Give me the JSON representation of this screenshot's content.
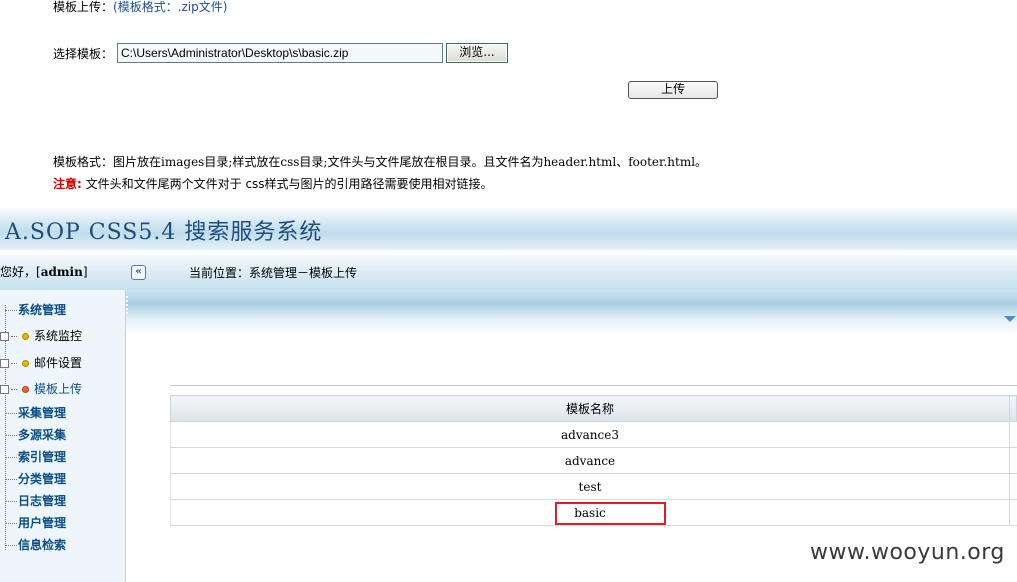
{
  "upload_form": {
    "title_label": "模板上传：",
    "title_hint": "(模板格式：.zip文件)",
    "select_label": "选择模板：",
    "file_path": "C:\\Users\\Administrator\\Desktop\\s\\basic.zip",
    "browse_label": "浏览...",
    "upload_label": "上传",
    "format_prefix": "模板格式：",
    "format_text": "图片放在images目录;样式放在css目录;文件头与文件尾放在根目录。且文件名为header.html、footer.html。",
    "note_label": "注意:",
    "note_text": "文件头和文件尾两个文件对于 css样式与图片的引用路径需要使用相对链接。"
  },
  "app": {
    "title": "A.SOP CSS5.4 搜索服务系统",
    "greeting_prefix": "您好，[",
    "username": "admin",
    "greeting_suffix": "]",
    "collapse_icon": "double-chevron-left-icon",
    "collapse_glyph": "«",
    "location": "当前位置：系统管理－模板上传"
  },
  "sidebar": {
    "items": [
      {
        "label": "系统管理",
        "level": "top"
      },
      {
        "label": "系统监控",
        "level": "sub",
        "icon": "yellow-dot-icon"
      },
      {
        "label": "邮件设置",
        "level": "sub",
        "icon": "yellow-dot-icon"
      },
      {
        "label": "模板上传",
        "level": "sub",
        "icon": "orange-dot-icon",
        "active": true
      },
      {
        "label": "采集管理",
        "level": "top"
      },
      {
        "label": "多源采集",
        "level": "top"
      },
      {
        "label": "索引管理",
        "level": "top"
      },
      {
        "label": "分类管理",
        "level": "top"
      },
      {
        "label": "日志管理",
        "level": "top"
      },
      {
        "label": "用户管理",
        "level": "top"
      },
      {
        "label": "信息检索",
        "level": "top"
      }
    ]
  },
  "template_table": {
    "header": "模板名称",
    "rows": [
      "advance3",
      "advance",
      "test",
      "basic"
    ],
    "highlighted_row": "basic"
  },
  "colors": {
    "accent_blue": "#0b4f86",
    "warning_red": "#d40000",
    "highlight_red": "#e02020"
  },
  "watermark": "www.wooyun.org"
}
